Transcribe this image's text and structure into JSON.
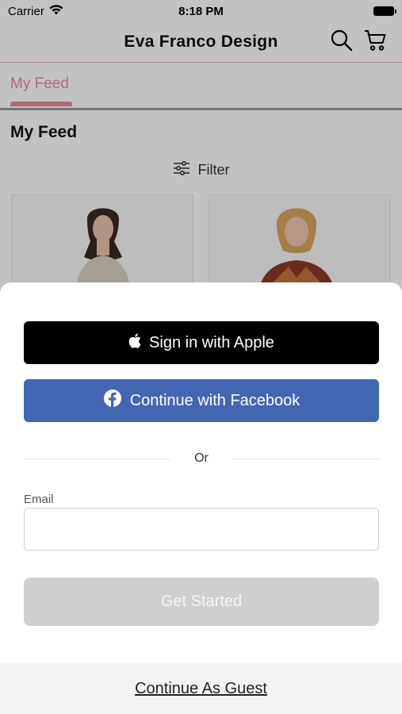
{
  "status_bar": {
    "carrier": "Carrier",
    "time": "8:18 PM"
  },
  "nav": {
    "title": "Eva Franco Design",
    "icons": [
      "search-icon",
      "cart-icon"
    ]
  },
  "tabs": {
    "active_label": "My Feed"
  },
  "feed": {
    "heading": "My Feed",
    "filter_label": "Filter"
  },
  "sheet": {
    "apple_label": "Sign in with Apple",
    "facebook_label": "Continue with Facebook",
    "or_label": "Or",
    "email_label": "Email",
    "email_value": "",
    "email_placeholder": "",
    "get_started_label": "Get Started",
    "guest_label": "Continue As Guest"
  },
  "colors": {
    "accent_pink": "#e58a97",
    "facebook_blue": "#4267b2",
    "apple_black": "#000000",
    "disabled_gray": "#cfcfcf"
  }
}
